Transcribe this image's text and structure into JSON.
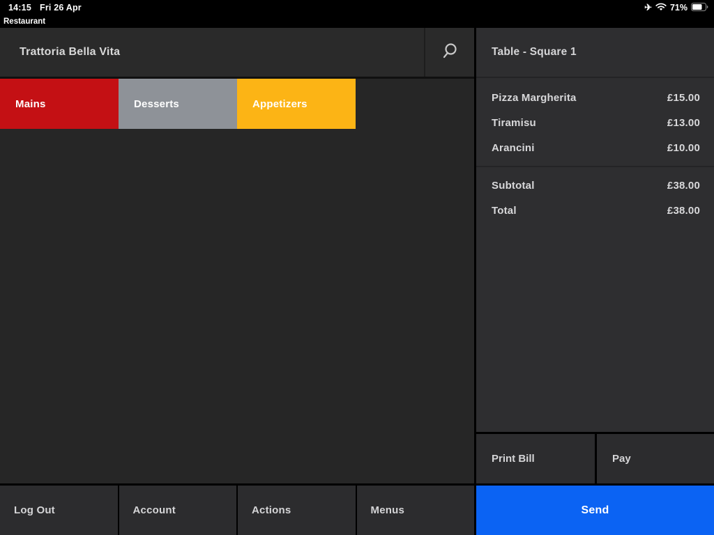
{
  "status_bar": {
    "time": "14:15",
    "date": "Fri 26 Apr",
    "app_label": "Restaurant",
    "battery_percent": "71%",
    "icons": [
      "airplane-mode",
      "wifi",
      "battery"
    ]
  },
  "header": {
    "venue_name": "Trattoria Bella Vita",
    "search_icon": "magnifier"
  },
  "categories": [
    {
      "label": "Mains",
      "color": "#c41014"
    },
    {
      "label": "Desserts",
      "color": "#8e9298"
    },
    {
      "label": "Appetizers",
      "color": "#fcb415"
    }
  ],
  "order_panel": {
    "title": "Table - Square 1",
    "items": [
      {
        "name": "Pizza Margherita",
        "price": "£15.00"
      },
      {
        "name": "Tiramisu",
        "price": "£13.00"
      },
      {
        "name": "Arancini",
        "price": "£10.00"
      }
    ],
    "summary": [
      {
        "label": "Subtotal",
        "value": "£38.00"
      },
      {
        "label": "Total",
        "value": "£38.00"
      }
    ],
    "actions": {
      "print_bill": "Print Bill",
      "pay": "Pay",
      "send": "Send"
    },
    "send_color": "#0b63f3"
  },
  "bottom_nav": [
    {
      "label": "Log Out"
    },
    {
      "label": "Account"
    },
    {
      "label": "Actions"
    },
    {
      "label": "Menus"
    }
  ]
}
